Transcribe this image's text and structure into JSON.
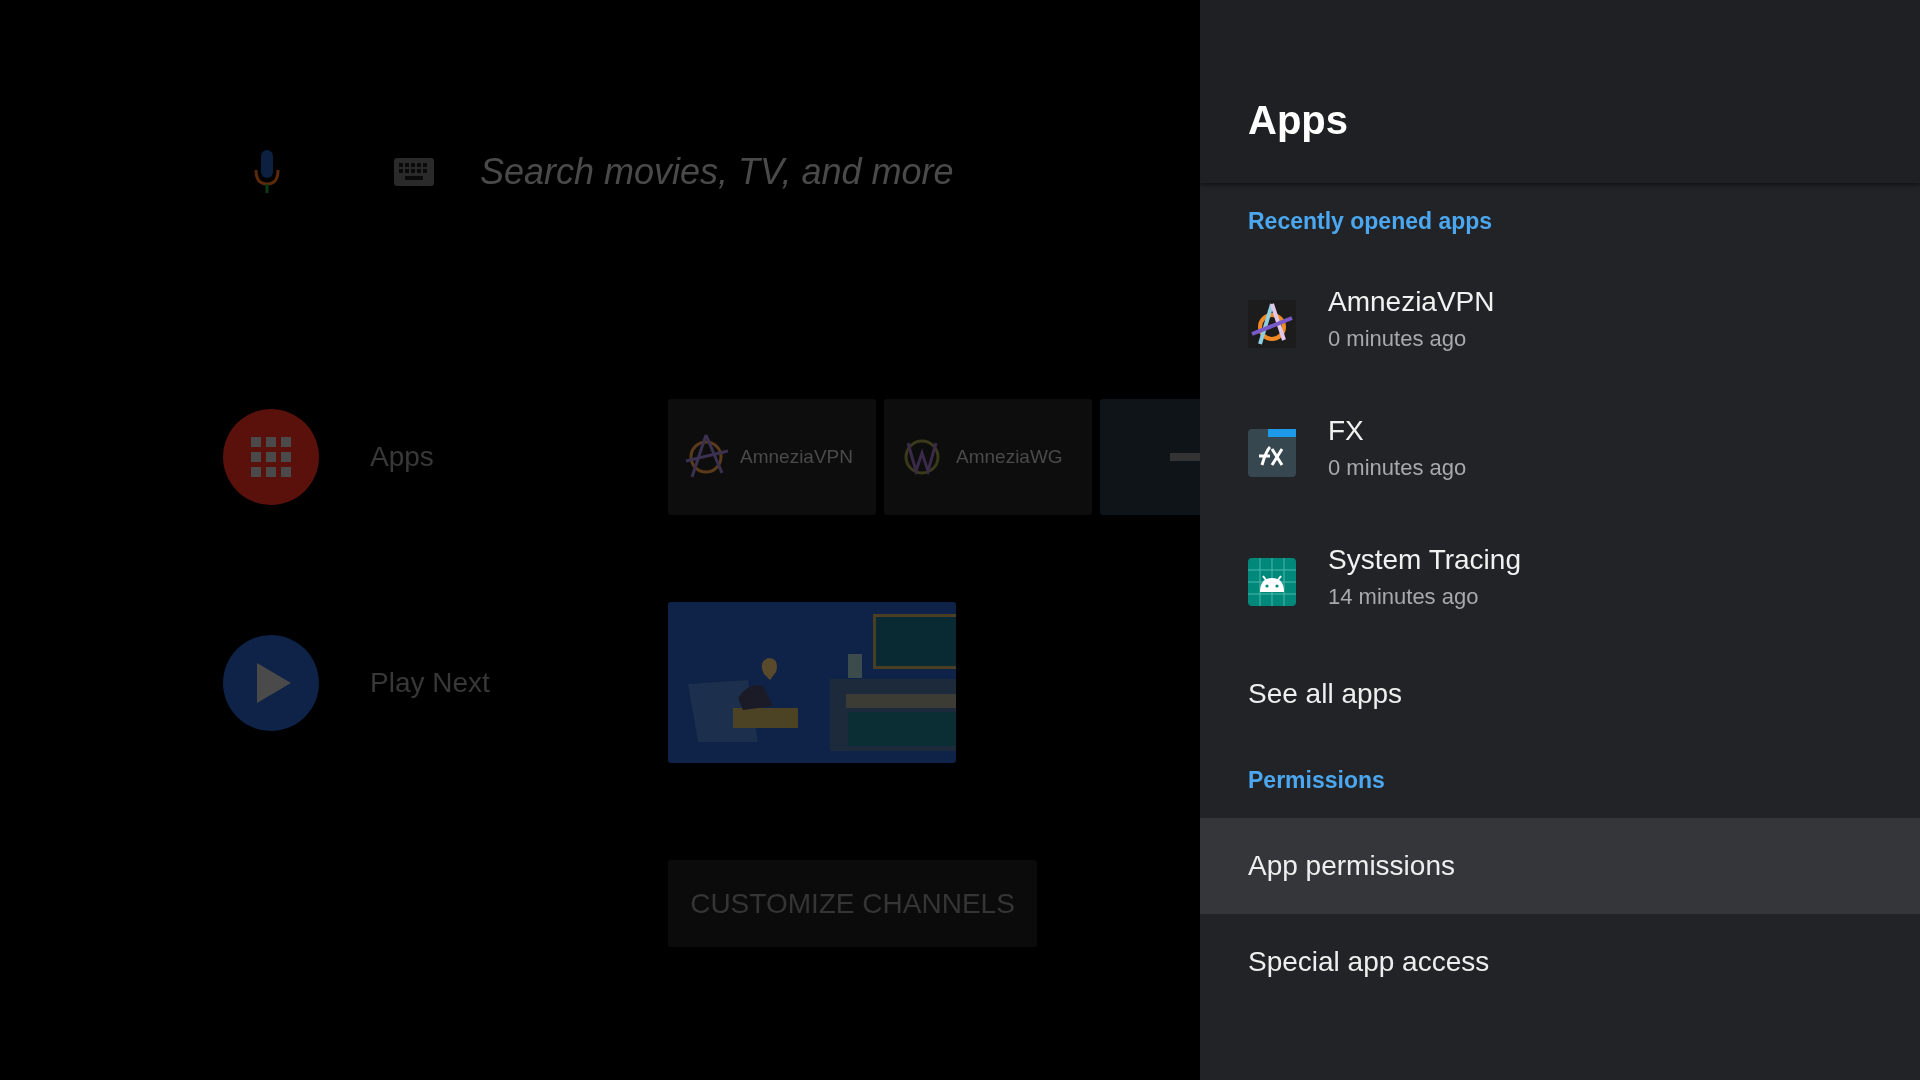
{
  "search": {
    "placeholder": "Search movies, TV, and more"
  },
  "apps_row": {
    "label": "Apps",
    "tiles": [
      "AmneziaVPN",
      "AmneziaWG"
    ]
  },
  "play_next": {
    "label": "Play Next"
  },
  "customize_button": "CUSTOMIZE CHANNELS",
  "panel": {
    "title": "Apps",
    "sections": [
      {
        "heading": "Recently opened apps",
        "items": [
          {
            "kind": "app",
            "name": "AmneziaVPN",
            "time": "0 minutes ago",
            "selected": false
          },
          {
            "kind": "app",
            "name": "FX",
            "time": "0 minutes ago",
            "selected": false
          },
          {
            "kind": "app",
            "name": "System Tracing",
            "time": "14 minutes ago",
            "selected": false
          },
          {
            "kind": "link",
            "label": "See all apps",
            "selected": false
          }
        ]
      },
      {
        "heading": "Permissions",
        "items": [
          {
            "kind": "link",
            "label": "App permissions",
            "selected": true
          },
          {
            "kind": "link",
            "label": "Special app access",
            "selected": false
          }
        ]
      }
    ]
  }
}
